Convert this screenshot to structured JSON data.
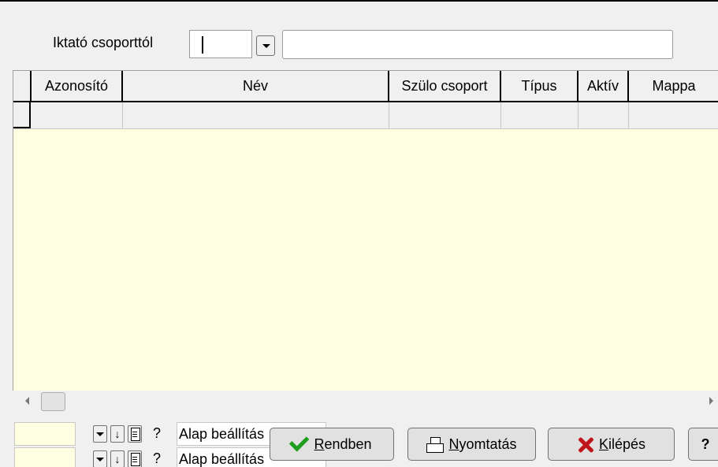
{
  "filter": {
    "label": "Iktató csoporttól",
    "code_value": "",
    "name_value": ""
  },
  "grid": {
    "columns": [
      "Azonosító",
      "Név",
      "Szülo csoport",
      "Típus",
      "Aktív",
      "Mappa"
    ],
    "rows": []
  },
  "bottom": {
    "preset_1": "Alap beállítás",
    "preset_2": "Alap beállítás",
    "help_glyph": "?",
    "ok_label_mnemonic": "R",
    "ok_label_rest": "endben",
    "print_label_mnemonic": "N",
    "print_label_rest": "yomtatás",
    "exit_label_mnemonic": "K",
    "exit_label_rest": "ilépés",
    "help_label": "?"
  },
  "colors": {
    "grid_background": "#ffffe1",
    "window_background": "#f0f0f0",
    "ok_icon": "#1e9d1e",
    "exit_icon": "#c0141b"
  },
  "icons": [
    "chevron-down-icon",
    "arrow-down-icon",
    "document-icon",
    "question-icon",
    "checkmark-icon",
    "printer-icon",
    "close-icon"
  ]
}
